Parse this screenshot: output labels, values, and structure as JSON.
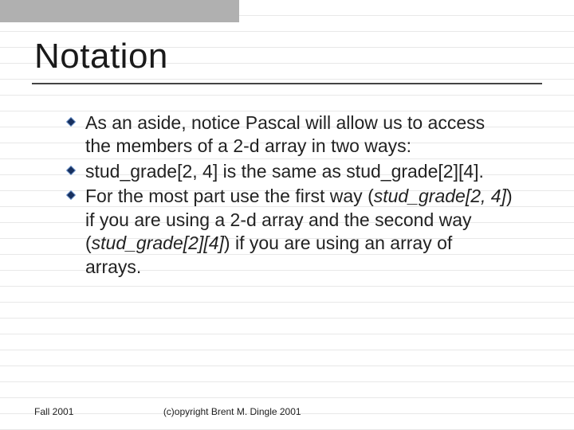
{
  "title": "Notation",
  "bullets": [
    {
      "pre": "As an aside, notice Pascal will allow us to access the members of a 2-d array in two ways:",
      "em": "",
      "post": ""
    },
    {
      "pre": "stud_grade[2, 4] is the same as stud_grade[2][4].",
      "em": "",
      "post": ""
    },
    {
      "pre": "For the most part use the first way (",
      "em": "stud_grade[2, 4]",
      "mid": ") if you are using a 2-d array and the second way (",
      "em2": "stud_grade[2][4]",
      "post": ") if you are using an array of arrays."
    }
  ],
  "footer": {
    "left": "Fall 2001",
    "right": "(c)opyright Brent M. Dingle 2001"
  },
  "colors": {
    "bullet_fill": "#17305f",
    "bullet_edge": "#7fa3d6"
  }
}
